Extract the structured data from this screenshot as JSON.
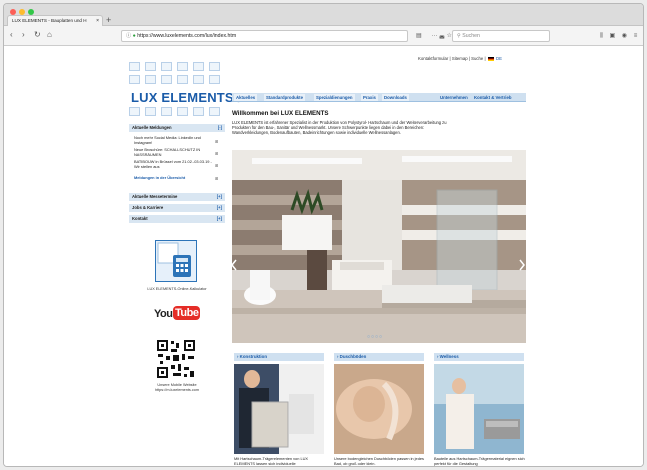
{
  "browser": {
    "tab_title": "LUX ELEMENTS - Bauplatten und Polystyrol- Hartschaum-Formteile für Bad, Wellness und Sanitär",
    "tab_short": "LUX ELEMENTS - Bauplatten und H",
    "tab_close": "×",
    "new_tab": "+",
    "url": "https://www.luxelements.com/lux/index.htm",
    "search_placeholder": "Suchen",
    "colors": {
      "close": "#fc5f57",
      "minimize": "#fdbc2e",
      "zoom": "#33c748"
    }
  },
  "header": {
    "top_links": "Kontaktformular  |  Sitemap  |  Suche  |",
    "lang": "DE",
    "logo_text": "LUX ELEMENTS®",
    "logo_reg": "®"
  },
  "menu": {
    "left": [
      "Aktuelles",
      "Standardprodukte",
      "Spezialdienungen",
      "Praxis",
      "Downloads"
    ],
    "right": [
      "Unternehmen",
      "Kontakt & Vertrieb"
    ]
  },
  "sidebar": {
    "news_header": "Aktuelle Meldungen",
    "news": [
      "Noch mehr Social Media: LinkedIn und Instagram!",
      "Neue Broschüre: SCHALLSCHUTZ IN NASSRÄUMEN",
      "BATIBOUW in Brüssel vom 21.02.-03.03.19 - Wir stellen aus"
    ],
    "news_overview": "Meldungen in der Übersicht",
    "sections": [
      "Aktuelle Messetermine",
      "Jobs & Karriere",
      "Kontakt"
    ],
    "calc_label": "LUX ELEMENTS-Online-Kalkulator",
    "youtube": {
      "you": "You",
      "tube": "Tube"
    },
    "mobile": [
      "Unsere Mobile Website",
      "https://m.luxelements.com"
    ]
  },
  "main": {
    "welcome": "Willkommen bei LUX ELEMENTS",
    "intro": "LUX ELEMENTS ist erfahrener Spezialist in der Produktion von Polystyrol- Hartschaum und der Weiterverarbeitung zu Produkten für den Bau-, Sanitär und Wellnessmarkt. Unsere Schwerpunkte liegen dabei in den Bereichen: Wandverkleidungen, Bodenaufbauten, Badeinrichtungen sowie individuelle Wellnessanlagen.",
    "cards": [
      {
        "title": "› Konstruktion",
        "text": "Mit Hartschaum-Trägerelementen von LUX ELEMENTS lassen sich individuelle"
      },
      {
        "title": "› Duschböden",
        "text": "Unsere bodengleichen Duschböden passen in jedes Bad, ob groß oder klein."
      },
      {
        "title": "› Wellness",
        "text": "Bauteile aus Hartschaum-Trägermaterial eignen sich perfekt für die Gestaltung"
      }
    ]
  }
}
